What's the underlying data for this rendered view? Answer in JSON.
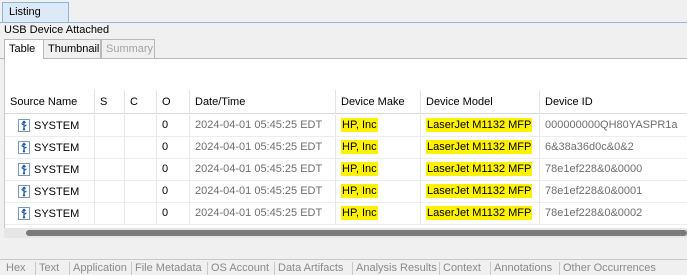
{
  "top_tab": "Listing",
  "heading": "USB Device Attached",
  "subtabs": [
    {
      "label": "Table",
      "state": "active"
    },
    {
      "label": "Thumbnail",
      "state": "normal"
    },
    {
      "label": "Summary",
      "state": "disabled"
    }
  ],
  "columns": [
    "Source Name",
    "S",
    "C",
    "O",
    "Date/Time",
    "Device Make",
    "Device Model",
    "Device ID"
  ],
  "rows": [
    {
      "icon": "usb-device-icon",
      "source": "SYSTEM",
      "s": "",
      "c": "",
      "o": "0",
      "datetime": "2024-04-01 05:45:25 EDT",
      "make": "HP, Inc",
      "model": "LaserJet M1132 MFP",
      "device_id": "000000000QH80YASPR1a"
    },
    {
      "icon": "usb-device-icon",
      "source": "SYSTEM",
      "s": "",
      "c": "",
      "o": "0",
      "datetime": "2024-04-01 05:45:25 EDT",
      "make": "HP, Inc",
      "model": "LaserJet M1132 MFP",
      "device_id": "6&38a36d0c&0&2"
    },
    {
      "icon": "usb-device-icon",
      "source": "SYSTEM",
      "s": "",
      "c": "",
      "o": "0",
      "datetime": "2024-04-01 05:45:25 EDT",
      "make": "HP, Inc",
      "model": "LaserJet M1132 MFP",
      "device_id": "78e1ef228&0&0000"
    },
    {
      "icon": "usb-device-icon",
      "source": "SYSTEM",
      "s": "",
      "c": "",
      "o": "0",
      "datetime": "2024-04-01 05:45:25 EDT",
      "make": "HP, Inc",
      "model": "LaserJet M1132 MFP",
      "device_id": "78e1ef228&0&0001"
    },
    {
      "icon": "usb-device-icon",
      "source": "SYSTEM",
      "s": "",
      "c": "",
      "o": "0",
      "datetime": "2024-04-01 05:45:25 EDT",
      "make": "HP, Inc",
      "model": "LaserJet M1132 MFP",
      "device_id": "78e1ef228&0&0002"
    }
  ],
  "bottom_tabs": [
    "Hex",
    "Text",
    "Application",
    "File Metadata",
    "OS Account",
    "Data Artifacts",
    "Analysis Results",
    "Context",
    "Annotations",
    "Other Occurrences"
  ],
  "colors": {
    "highlight": "#fff200",
    "tab_active_bg": "#dce9f7",
    "tab_border": "#8fb3d9",
    "disabled_text": "#a3a3a3"
  }
}
